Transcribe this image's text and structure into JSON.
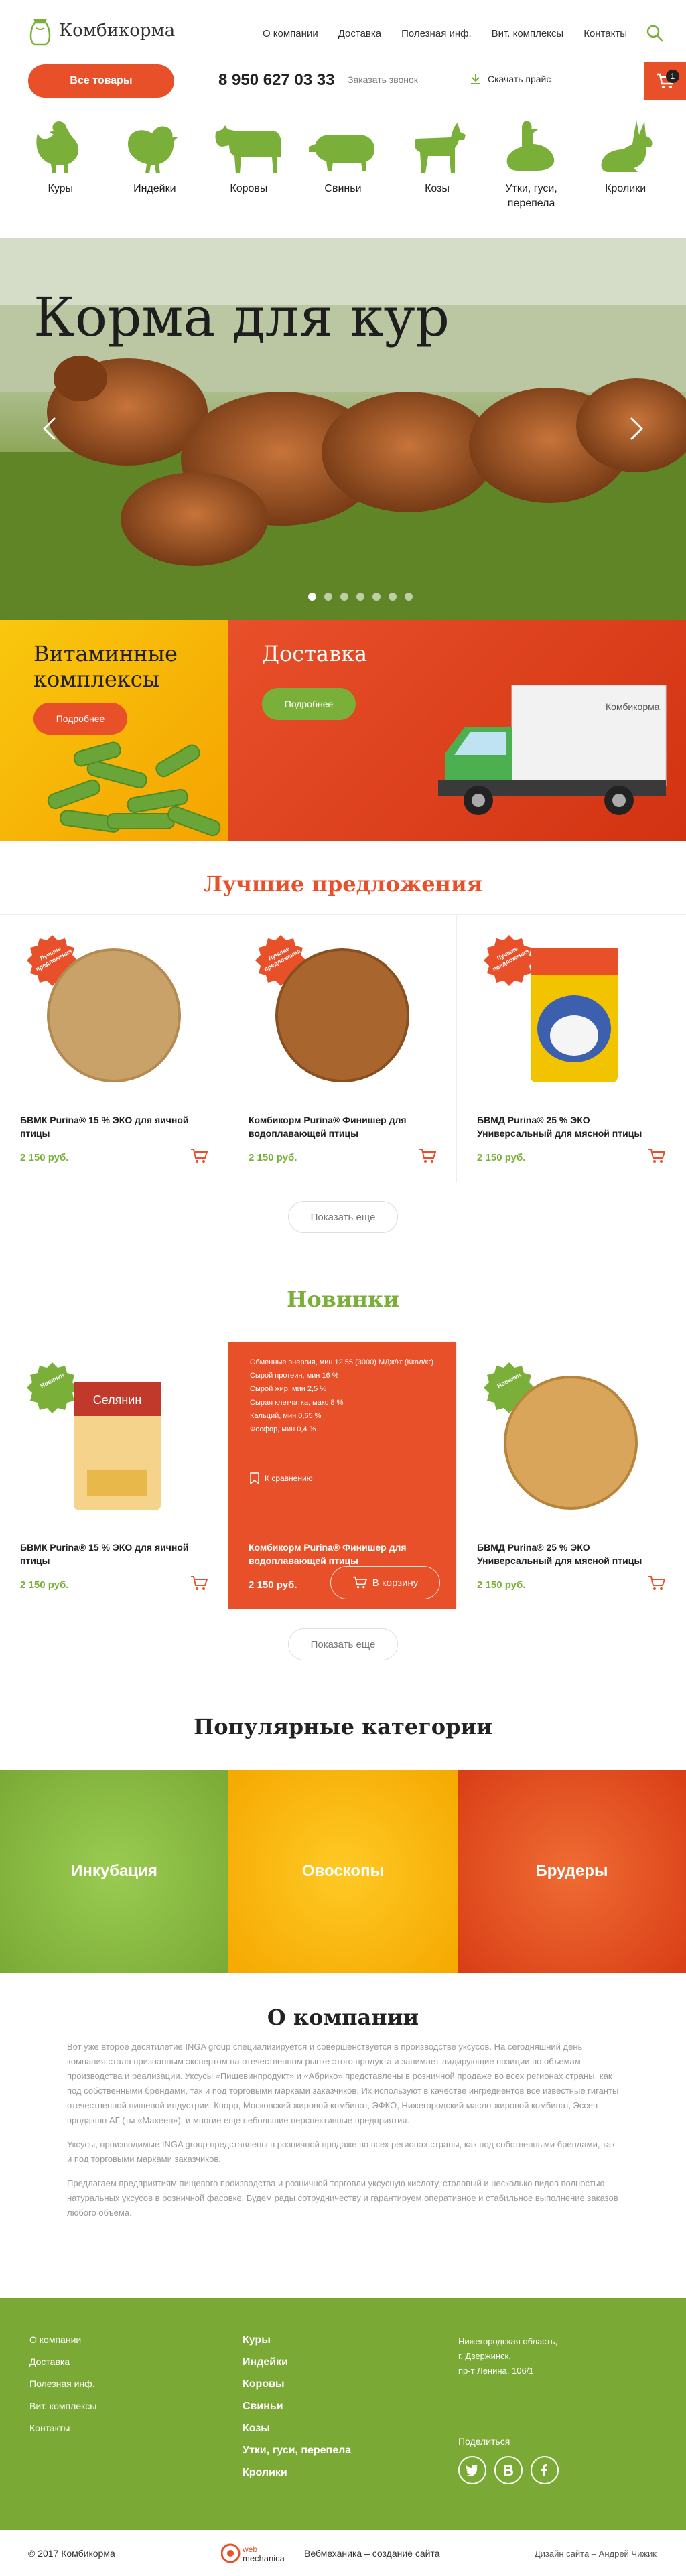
{
  "header": {
    "logo_text": "Комбикорма",
    "nav": [
      "О компании",
      "Доставка",
      "Полезная инф.",
      "Вит. комплексы",
      "Контакты"
    ],
    "all_goods": "Все товары",
    "phone": "8 950 627 03 33",
    "order_call": "Заказать звонок",
    "download": "Скачать прайс",
    "cart_count": "1"
  },
  "animals": [
    {
      "label": "Куры",
      "icon": "chicken-icon"
    },
    {
      "label": "Индейки",
      "icon": "turkey-icon"
    },
    {
      "label": "Коровы",
      "icon": "cow-icon"
    },
    {
      "label": "Свиньи",
      "icon": "pig-icon"
    },
    {
      "label": "Козы",
      "icon": "goat-icon"
    },
    {
      "label": "Утки, гуси, перепела",
      "icon": "duck-icon"
    },
    {
      "label": "Кролики",
      "icon": "rabbit-icon"
    }
  ],
  "hero": {
    "title": "Корма для кур"
  },
  "promo": [
    {
      "title": "Витаминные комплексы",
      "button": "Подробнее"
    },
    {
      "title": "Доставка",
      "button": "Подробнее",
      "truck_label": "Комбикорма"
    }
  ],
  "best": {
    "title": "Лучшие предложения",
    "badge": "Лучшие предложения",
    "items": [
      {
        "name": "БВМК Purina® 15 % ЭКО для яичной птицы",
        "price": "2 150 руб."
      },
      {
        "name": "Комбикорм Purina® Финишер для водоплавающей птицы",
        "price": "2 150 руб."
      },
      {
        "name": "БВМД Purina® 25 % ЭКО Универсальный для мясной птицы",
        "price": "2 150 руб."
      }
    ],
    "more": "Показать еще"
  },
  "news": {
    "title": "Новинки",
    "badge": "Новинки",
    "package_label": "Селянин",
    "items": [
      {
        "name": "БВМК Purina® 15 % ЭКО для яичной птицы",
        "price": "2 150 руб."
      },
      {
        "name": "Комбикорм Purina® Финишер для водоплавающей птицы",
        "price": "2 150 руб.",
        "specs": [
          "Обменные энергия, мин 12,55 (3000) МДж/кг (Ккал/кг)",
          "Сырой протеин, мин 16 %",
          "Сырой жир, мин 2,5 %",
          "Сырая клетчатка, макс 8 %",
          "Кальций, мин 0,65 %",
          "Фосфор, мин 0,4 %"
        ],
        "compare": "К сравнению",
        "buy": "В корзину"
      },
      {
        "name": "БВМД Purina® 25 % ЭКО Универсальный для мясной птицы",
        "price": "2 150 руб."
      }
    ],
    "more": "Показать еще"
  },
  "categories": {
    "title": "Популярные категории",
    "items": [
      "Инкубация",
      "Овоскопы",
      "Брудеры"
    ]
  },
  "about": {
    "title": "О компании",
    "paragraphs": [
      "Вот уже второе десятилетие INGA group специализируется и совершенствуется в производстве уксусов. На сегодняшний день компания стала признанным экспертом на отечественном рынке этого продукта и занимает лидирующие позиции по объемам производства и реализации. Уксусы «Пищевинпродукт» и «Абрико» представлены в розничной продаже во всех регионах страны, как под собственными брендами, так и под торговыми марками заказчиков. Их используют в качестве ингредиентов все известные гиганты отечественной пищевой индустрии: Кнорр, Московский жировой комбинат, ЭФКО, Нижегородский масло-жировой комбинат, Эссен продакшн АГ (тм «Махеев»), и многие еще небольшие перспективные предприятия.",
      "Уксусы, производимые INGA group представлены в розничной продаже во всех регионах страны, как под собственными брендами, так и под торговыми марками заказчиков.",
      "Предлагаем предприятиям пищевого производства и розничной торговли уксусную кислоту, столовый и несколько видов полностью натуральных уксусов в розничной фасовке. Будем рады сотрудничеству и гарантируем оперативное и стабильное выполнение заказов любого объема."
    ]
  },
  "footer": {
    "links": [
      "О компании",
      "Доставка",
      "Полезная инф.",
      "Вит. комплексы",
      "Контакты"
    ],
    "categories": [
      "Куры",
      "Индейки",
      "Коровы",
      "Свиньи",
      "Козы",
      "Утки, гуси, перепела",
      "Кролики"
    ],
    "address": [
      "Нижегородская область,",
      "г. Дзержинск,",
      "пр-т Ленина, 106/1"
    ],
    "share": "Поделиться",
    "copyright": "© 2017 Комбикорма",
    "dev_logo_top": "web",
    "dev_logo": "mechanica",
    "dev_text": "Вебмеханика – создание сайта",
    "designer": "Дизайн сайта – Андрей Чижик"
  },
  "colors": {
    "accent": "#e8502a",
    "green": "#7ab03a",
    "yellow": "#f5a800"
  }
}
